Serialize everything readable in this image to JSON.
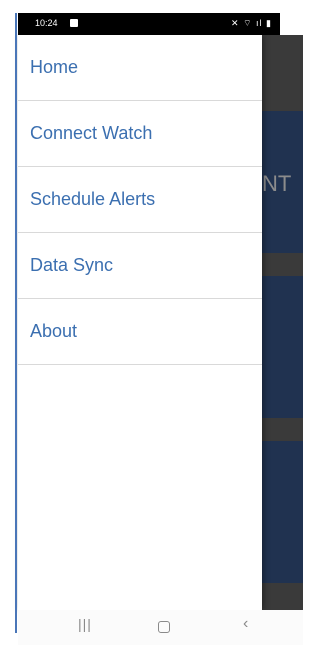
{
  "status_bar": {
    "time": "10:24",
    "right_icons": "✕ ⌔ ıl ▮"
  },
  "drawer": {
    "items": [
      {
        "label": "Home"
      },
      {
        "label": "Connect Watch"
      },
      {
        "label": "Schedule Alerts"
      },
      {
        "label": "Data Sync"
      },
      {
        "label": "About"
      }
    ]
  },
  "background": {
    "peek_text": "NT"
  },
  "nav_bar": {
    "recents": "|||",
    "back": "‹"
  },
  "colors": {
    "menu_text": "#3b6fb0",
    "band": "#203250",
    "scrim": "#3a3a3a"
  }
}
